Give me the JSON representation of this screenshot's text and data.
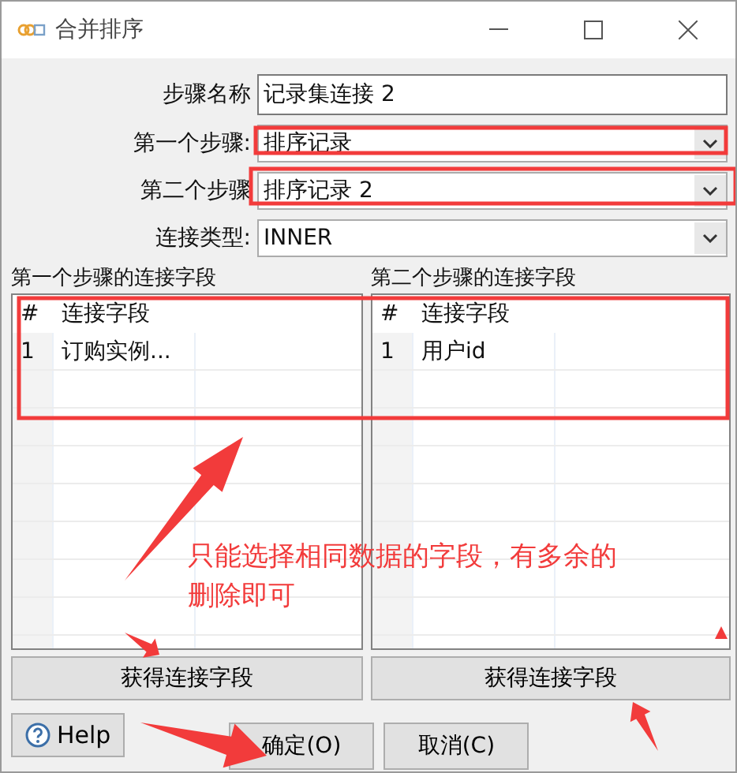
{
  "window": {
    "title": "合并排序"
  },
  "form": [
    {
      "kind": "text",
      "label": "步骤名称",
      "value": "记录集连接 2"
    },
    {
      "kind": "combo",
      "label": "第一个步骤:",
      "value": "排序记录"
    },
    {
      "kind": "combo",
      "label": "第二个步骤",
      "value": "排序记录 2"
    },
    {
      "kind": "combo",
      "label": "连接类型:",
      "value": "INNER"
    }
  ],
  "tables": [
    {
      "label": "第一个步骤的连接字段",
      "columns": [
        "#",
        "连接字段"
      ],
      "rows": [
        [
          "1",
          "订购实例..."
        ]
      ],
      "button": "获得连接字段"
    },
    {
      "label": "第二个步骤的连接字段",
      "columns": [
        "#",
        "连接字段"
      ],
      "rows": [
        [
          "1",
          "用户id"
        ]
      ],
      "button": "获得连接字段"
    }
  ],
  "footer": {
    "help": "Help",
    "ok": "确定(O)",
    "cancel": "取消(C)"
  },
  "annotation": {
    "note": "只能选择相同数据的字段，有多余的删除即可"
  }
}
